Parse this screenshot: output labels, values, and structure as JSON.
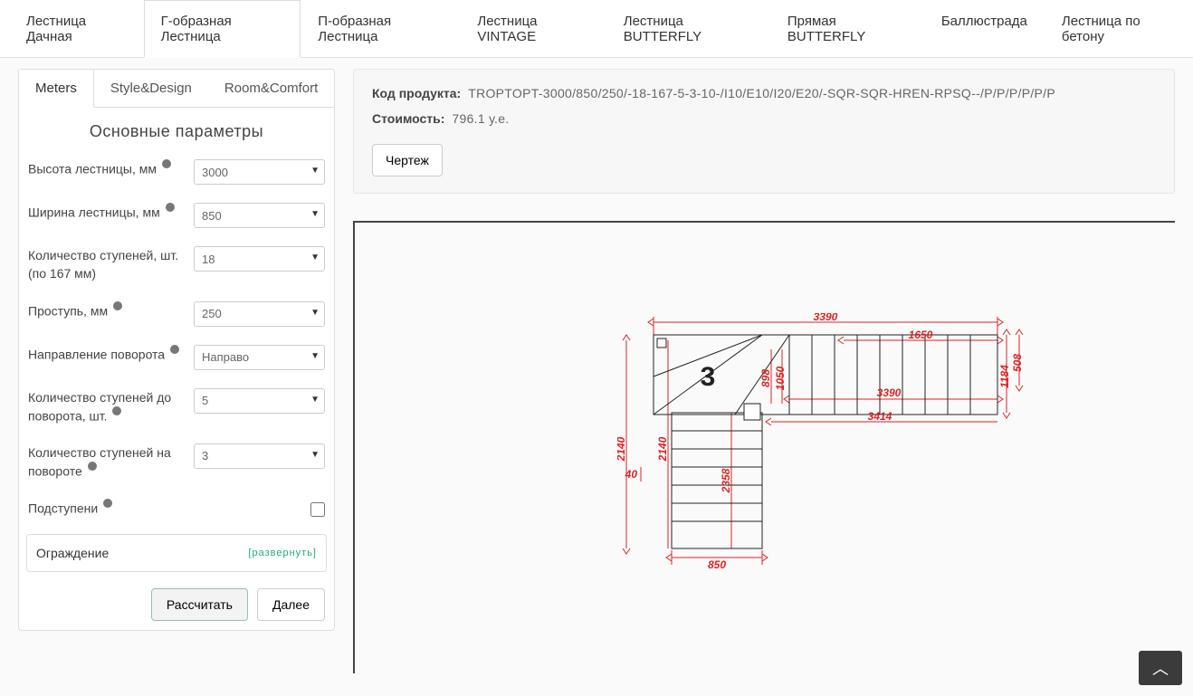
{
  "mainTabs": {
    "t0": "Лестница Дачная",
    "t1": "Г-образная Лестница",
    "t2": "П-образная Лестница",
    "t3": "Лестница VINTAGE",
    "t4": "Лестница BUTTERFLY",
    "t5": "Прямая BUTTERFLY",
    "t6": "Баллюстрада",
    "t7": "Лестница по бетону"
  },
  "innerTabs": {
    "t0": "Meters",
    "t1": "Style&Design",
    "t2": "Room&Comfort"
  },
  "panel": {
    "heading": "Основные параметры",
    "labels": {
      "height": "Высота лестницы, мм",
      "width": "Ширина лестницы, мм",
      "steps": "Количество ступеней, шт. (по 167 мм)",
      "tread": "Проступь, мм",
      "direction": "Направление поворота",
      "beforeTurn": "Количество ступеней до поворота, шт.",
      "onTurn": "Количество ступеней на повороте",
      "risers": "Подступени"
    },
    "values": {
      "height": "3000",
      "width": "850",
      "steps": "18",
      "tread": "250",
      "direction": "Направо",
      "beforeTurn": "5",
      "onTurn": "3"
    },
    "collapse": {
      "label": "Ограждение",
      "link": "[развернуть]"
    },
    "buttons": {
      "calc": "Рассчитать",
      "next": "Далее"
    }
  },
  "info": {
    "codeLabel": "Код продукта:",
    "codeValue": "TROPTOPT-3000/850/250/-18-167-5-3-10-/I10/E10/I20/E20/-SQR-SQR-HREN-RPSQ--/P/P/P/P/P/P",
    "costLabel": "Стоимость:",
    "costValue": "796.1 у.е.",
    "drawingBtn": "Чертеж"
  },
  "drawing": {
    "viewLabel": "3",
    "dims": {
      "topWidth": "3390",
      "midWidth": "3390",
      "subWidth": "3414",
      "topSeg": "1650",
      "rightH1": "1184",
      "rightH2": "508",
      "midH1": "898",
      "midH2": "1050",
      "leftH": "2140",
      "leftH2": "2140",
      "leftSeg": "2358",
      "leftSmall": "40",
      "bottomW": "850"
    }
  }
}
